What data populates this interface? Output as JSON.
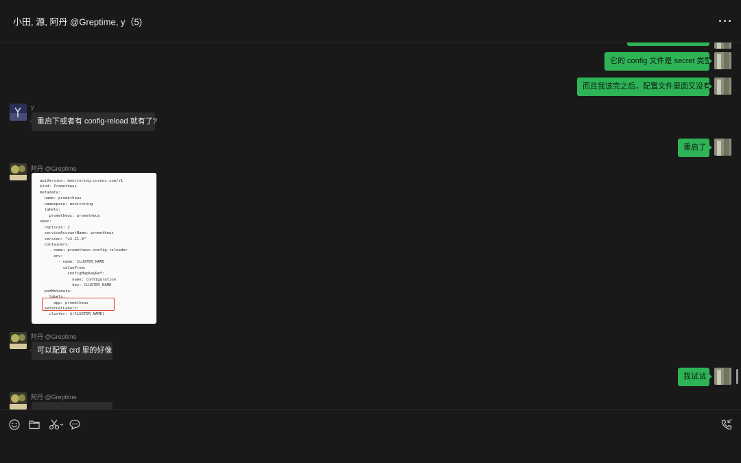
{
  "header": {
    "title": "小田, 源, 阿丹 @Greptime, y（5)",
    "more_icon": "more-horizontal-icon"
  },
  "messages": {
    "m0": {
      "text": "它的 config 文件是 secret 类型"
    },
    "m1": {
      "text": "而且我该完之后，配置文件里面又没有"
    },
    "m2": {
      "sender": "y",
      "text": "重启下或者有 config-reload 就有了?"
    },
    "m3": {
      "text": "重启了"
    },
    "m4": {
      "sender": "阿丹 @Greptime",
      "code": "apiVersion: monitoring.coreos.com/v1\nkind: Prometheus\nmetadata:\n  name: prometheus\n  namespace: monitoring\n  labels:\n    prometheus: prometheus\nspec:\n  replicas: 2\n  serviceAccountName: prometheus\n  version: \"v2.21.0\"\n  containers:\n    - name: prometheus-config-reloader\n      env:\n        - name: CLUSTER_NAME\n          valueFrom:\n            configMapKeyRef:\n              name: configuration\n              key: CLUSTER_NAME\n  podMetadata:\n    labels:\n      app: prometheus\n  externalLabels:\n    cluster: $(CLUSTER_NAME)"
    },
    "m5": {
      "sender": "阿丹 @Greptime",
      "text": "可以配置 crd 里的好像"
    },
    "m6": {
      "text": "我试试"
    },
    "m7": {
      "sender": "阿丹 @Greptime"
    }
  },
  "toolbar": {
    "icons": [
      "emoji-icon",
      "folder-icon",
      "scissors-icon",
      "chat-bubble-icon",
      "phone-icon"
    ]
  },
  "colors": {
    "background": "#191919",
    "outgoing_bubble": "#2eb356",
    "incoming_bubble": "#2c2c2c",
    "highlight_box": "#e0442c"
  }
}
